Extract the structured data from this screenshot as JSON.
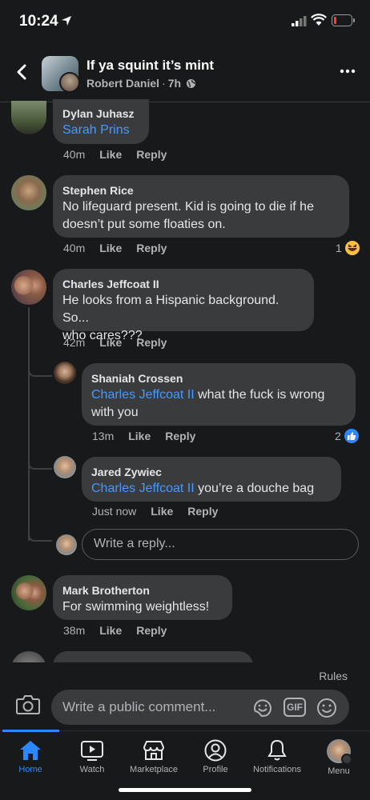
{
  "status_bar": {
    "time": "10:24"
  },
  "header": {
    "title": "If ya squint it’s mint",
    "author": "Robert Daniel",
    "separator": "·",
    "age": "7h"
  },
  "comments": [
    {
      "name": "Dylan Juhasz",
      "mention": "Sarah Prins",
      "text": "",
      "time": "40m",
      "like": "Like",
      "reply": "Reply"
    },
    {
      "name": "Stephen Rice",
      "text_line1": "No lifeguard present.  Kid is going to die if he",
      "text_line2": "doesn’t put some floaties on.",
      "time": "40m",
      "like": "Like",
      "reply": "Reply",
      "reaction_count": "1"
    },
    {
      "name": "Charles Jeffcoat II",
      "text_line1": "He looks from a Hispanic background. So...",
      "text_line2": "who cares???",
      "time": "42m",
      "like": "Like",
      "reply": "Reply"
    },
    {
      "name": "Mark Brotherton",
      "text": "For swimming weightless!",
      "time": "38m",
      "like": "Like",
      "reply": "Reply"
    }
  ],
  "replies": [
    {
      "name": "Shaniah Crossen",
      "mention": "Charles Jeffcoat II",
      "text_line1": " what the fuck is wrong",
      "text_line2": "with you",
      "time": "13m",
      "like": "Like",
      "reply": "Reply",
      "reaction_count": "2"
    },
    {
      "name": "Jared Zywiec",
      "mention": "Charles Jeffcoat II",
      "text": " you’re a douche bag",
      "time": "Just now",
      "like": "Like",
      "reply": "Reply"
    }
  ],
  "reply_box": {
    "placeholder": "Write a reply..."
  },
  "composer": {
    "rules": "Rules",
    "placeholder": "Write a public comment...",
    "gif": "GIF"
  },
  "tabs": [
    {
      "label": "Home",
      "active": true
    },
    {
      "label": "Watch"
    },
    {
      "label": "Marketplace"
    },
    {
      "label": "Profile"
    },
    {
      "label": "Notifications"
    },
    {
      "label": "Menu"
    }
  ],
  "colors": {
    "background": "#18191a",
    "bubble": "#3a3b3c",
    "accent": "#2d88ff",
    "mention": "#4599ff"
  },
  "icons": [
    "location-arrow-icon",
    "signal-icon",
    "wifi-icon",
    "battery-icon",
    "back-icon",
    "globe-icon",
    "more-icon",
    "laugh-emoji-icon",
    "like-icon",
    "camera-icon",
    "sticker-icon",
    "gif-icon",
    "emoji-icon",
    "home-icon",
    "watch-icon",
    "marketplace-icon",
    "profile-icon",
    "notifications-icon",
    "menu-icon"
  ]
}
